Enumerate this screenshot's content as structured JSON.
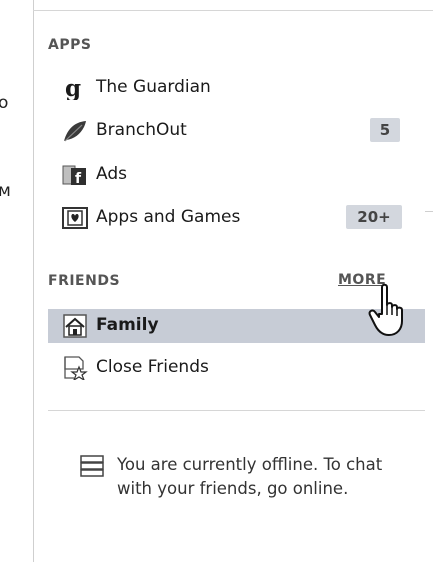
{
  "left_clip": {
    "top_char": "o",
    "bottom_char": "м"
  },
  "apps": {
    "title": "APPS",
    "items": [
      {
        "label": "The Guardian",
        "icon": "guardian-logo-icon"
      },
      {
        "label": "BranchOut",
        "icon": "branchout-leaf-icon",
        "badge": "5"
      },
      {
        "label": "Ads",
        "icon": "ads-icon"
      },
      {
        "label": "Apps and Games",
        "icon": "apps-games-icon",
        "badge": "20+"
      }
    ]
  },
  "friends": {
    "title": "FRIENDS",
    "more": "MORE",
    "items": [
      {
        "label": "Family",
        "icon": "family-house-icon",
        "selected": true
      },
      {
        "label": "Close Friends",
        "icon": "close-friends-star-icon"
      }
    ]
  },
  "chat": {
    "icon": "chat-icon",
    "offline_message": "You are currently offline. To chat with your friends, go online."
  },
  "colors": {
    "selected_bg": "#c7ccd6",
    "badge_bg": "#d3d7de",
    "heading": "#555555"
  }
}
